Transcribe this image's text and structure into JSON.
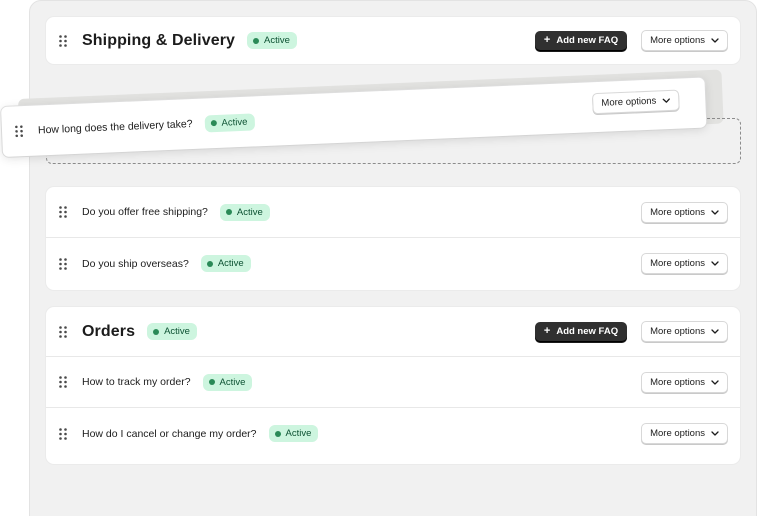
{
  "sections": [
    {
      "title": "Shipping & Delivery",
      "status": "Active",
      "add_label": "Add new FAQ",
      "more_label": "More options",
      "items": [
        {
          "question": "How long does the delivery take?",
          "status": "Active",
          "more_label": "More options"
        },
        {
          "question": "Do you offer free shipping?",
          "status": "Active",
          "more_label": "More options"
        },
        {
          "question": "Do you ship overseas?",
          "status": "Active",
          "more_label": "More options"
        }
      ]
    },
    {
      "title": "Orders",
      "status": "Active",
      "add_label": "Add new FAQ",
      "more_label": "More options",
      "items": [
        {
          "question": "How to track my order?",
          "status": "Active",
          "more_label": "More options"
        },
        {
          "question": "How do I cancel or change my order?",
          "status": "Active",
          "more_label": "More options"
        }
      ]
    }
  ],
  "icons": {
    "drag": "drag-handle-icon",
    "chevron": "chevron-down-icon",
    "plus": "plus-icon",
    "status_dot": "status-dot-icon"
  },
  "colors": {
    "badge_bg": "#cdf5df",
    "badge_text": "#0c5132",
    "badge_dot": "#2a8a57",
    "primary_button": "#303030",
    "panel_bg": "#f1f1f1"
  }
}
